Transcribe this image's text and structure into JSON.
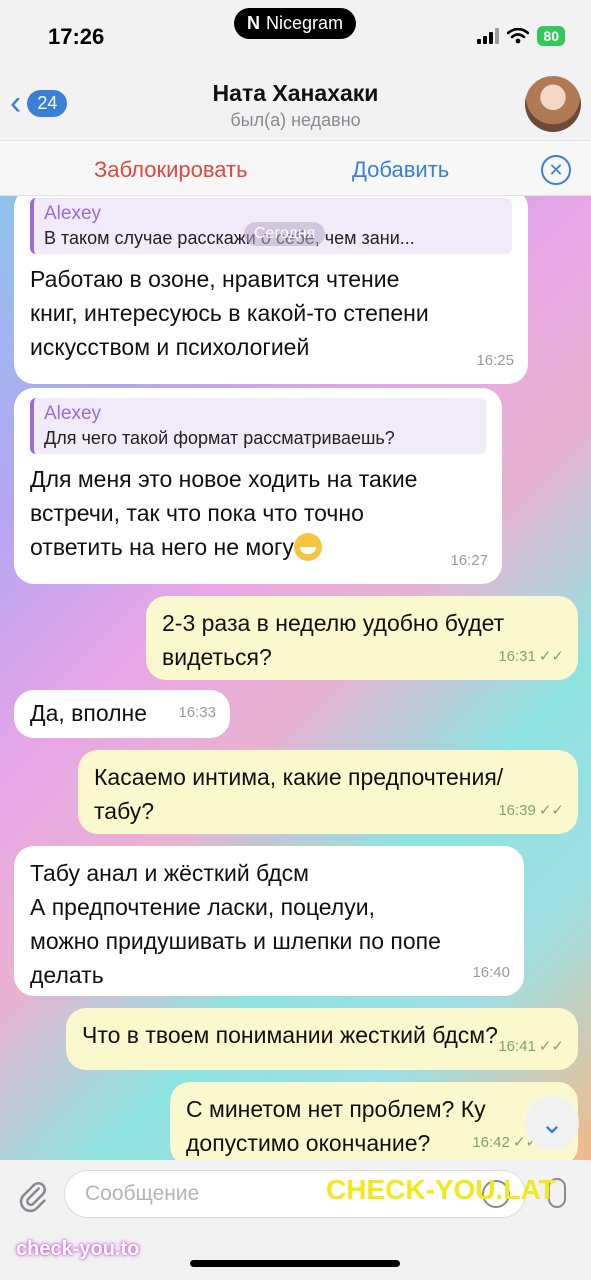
{
  "status_bar": {
    "time": "17:26",
    "pill_logo": "N",
    "pill_label": "Nicegram",
    "battery": "80"
  },
  "header": {
    "back_badge": "24",
    "title": "Ната Ханахаки",
    "subtitle": "был(а) недавно"
  },
  "action_bar": {
    "block_label": "Заблокировать",
    "add_label": "Добавить"
  },
  "chat": {
    "date_chip": "Сегодня",
    "messages": [
      {
        "direction": "in",
        "reply_name": "Alexey",
        "reply_text": "В таком случае расскажи о себе, чем зани...",
        "text": "Работаю в озоне, нравится чтение\nкниг, интересуюсь в какой-то степени\nискусством и психологией",
        "time": "16:25"
      },
      {
        "direction": "in",
        "reply_name": "Alexey",
        "reply_text": "Для чего такой формат рассматриваешь?",
        "text": "Для меня это новое ходить на такие\nвстречи, так что пока что точно\nответить на него не могу",
        "emoji": "grinning-sweat-emoji",
        "time": "16:27"
      },
      {
        "direction": "out",
        "text": "2-3 раза в неделю удобно будет\nвидеться?",
        "time": "16:31",
        "checks": "✓✓"
      },
      {
        "direction": "in",
        "text": "Да, вполне",
        "time": "16:33"
      },
      {
        "direction": "out",
        "text": "Касаемо интима, какие предпочтения/\nтабу?",
        "time": "16:39",
        "checks": "✓✓"
      },
      {
        "direction": "in",
        "text": "Табу анал и жёсткий бдсм\nА предпочтение ласки, поцелуи,\nможно придушивать и шлепки по попе\nделать",
        "time": "16:40"
      },
      {
        "direction": "out",
        "text": "Что в твоем понимании жесткий бдсм?",
        "time": "16:41",
        "checks": "✓✓"
      },
      {
        "direction": "out",
        "text": "С минетом нет проблем? Ку\nдопустимо окончание?",
        "time": "16:42",
        "checks": "✓✓"
      }
    ]
  },
  "input": {
    "placeholder": "Сообщение"
  },
  "watermarks": {
    "right": "CHECK-YOU.LAT",
    "left": "check-you.to"
  },
  "colors": {
    "accent": "#3a7fd5",
    "block_red": "#e0473d",
    "incoming_bubble": "#ffffff",
    "outgoing_bubble": "#fbf8ce",
    "reply_accent": "#9b6bd6"
  },
  "icons": {
    "back": "chevron-left-icon",
    "close": "close-circle-icon",
    "attach": "paperclip-icon",
    "sticker": "sticker-icon",
    "mic": "microphone-icon",
    "scroll": "chevron-down-icon"
  }
}
